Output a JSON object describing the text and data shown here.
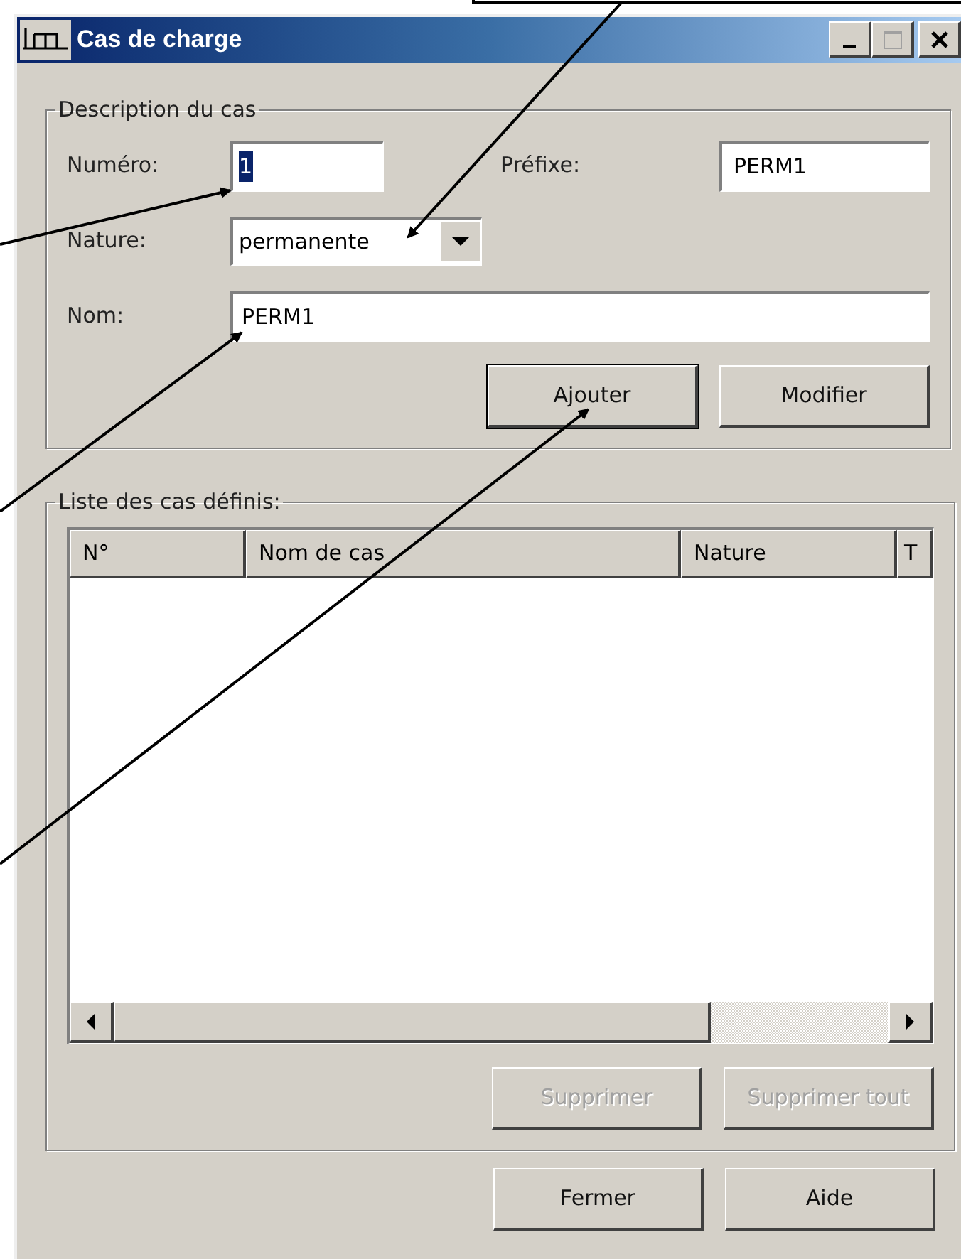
{
  "window": {
    "title": "Cas de charge",
    "controls": [
      {
        "kind": "minimize",
        "disabled": false
      },
      {
        "kind": "maximize",
        "disabled": true
      },
      {
        "kind": "close",
        "disabled": false
      }
    ]
  },
  "description": {
    "legend": "Description du cas",
    "numero": {
      "label": "Numéro:",
      "value": "1",
      "value_selected": true
    },
    "prefixe": {
      "label": "Préfixe:",
      "value": "PERM1"
    },
    "nature": {
      "label": "Nature:",
      "value": "permanente"
    },
    "nom": {
      "label": "Nom:",
      "value": "PERM1"
    },
    "buttons": [
      {
        "label": "Ajouter",
        "disabled": false,
        "default": true
      },
      {
        "label": "Modifier",
        "disabled": false,
        "default": false
      }
    ]
  },
  "list": {
    "legend": "Liste des cas définis:",
    "columns": [
      "N°",
      "Nom de cas",
      "Nature",
      "T"
    ],
    "buttons": [
      {
        "label": "Supprimer",
        "disabled": true
      },
      {
        "label": "Supprimer tout",
        "disabled": true
      }
    ]
  },
  "footer_buttons": [
    {
      "label": "Fermer",
      "disabled": false
    },
    {
      "label": "Aide",
      "disabled": false
    }
  ]
}
